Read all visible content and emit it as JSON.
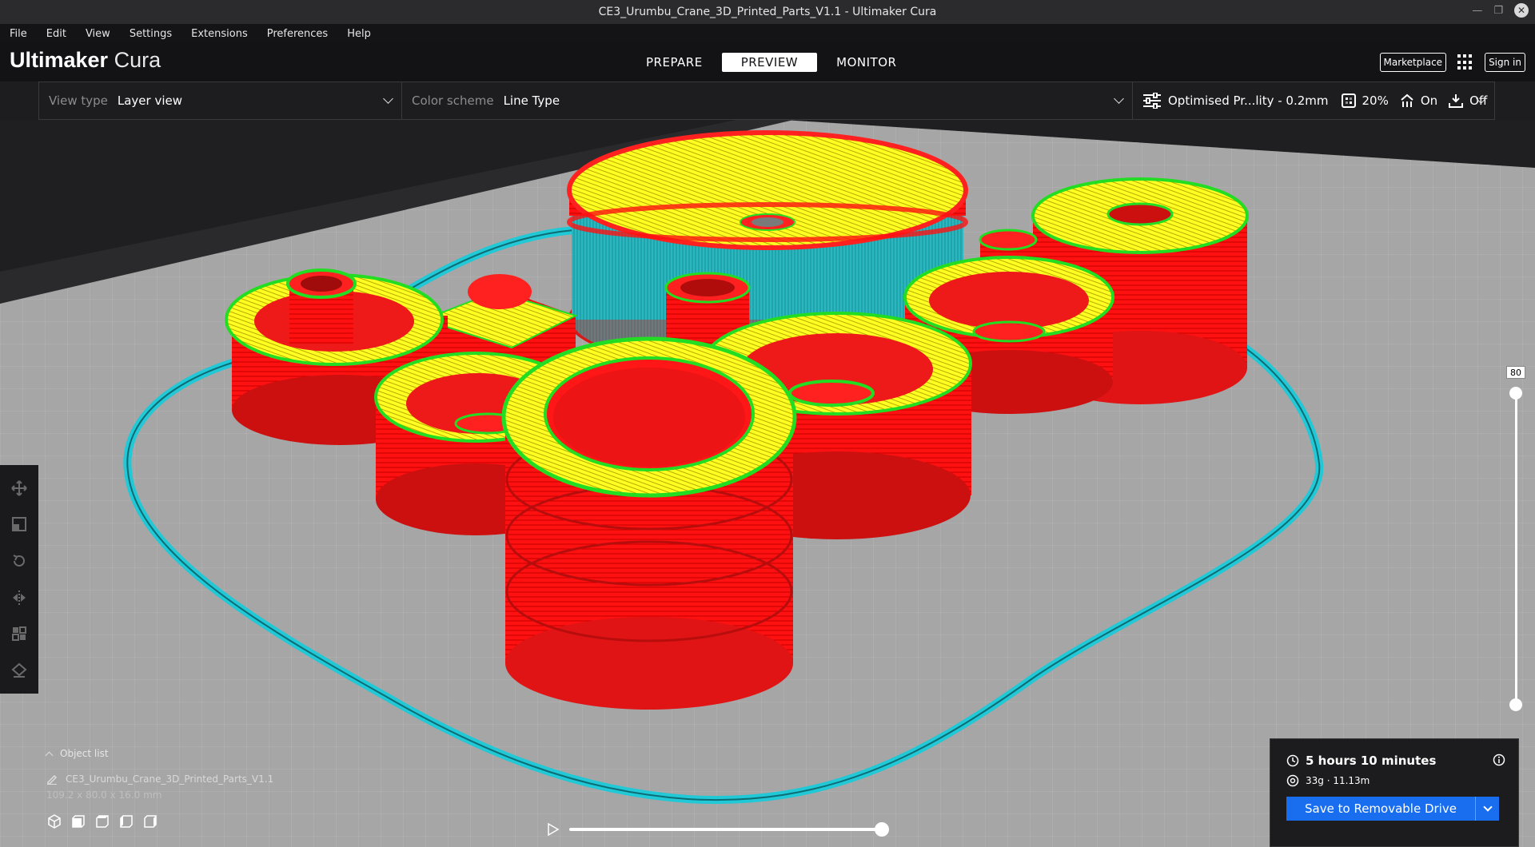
{
  "window": {
    "title": "CE3_Urumbu_Crane_3D_Printed_Parts_V1.1 - Ultimaker Cura"
  },
  "menu": [
    "File",
    "Edit",
    "View",
    "Settings",
    "Extensions",
    "Preferences",
    "Help"
  ],
  "header": {
    "logo_bold": "Ultimaker",
    "logo_light": "Cura",
    "stages": [
      {
        "label": "PREPARE",
        "active": false
      },
      {
        "label": "PREVIEW",
        "active": true
      },
      {
        "label": "MONITOR",
        "active": false
      }
    ],
    "marketplace_label": "Marketplace",
    "sign_in_label": "Sign in"
  },
  "toolbar": {
    "view_type_label": "View type",
    "view_type_value": "Layer view",
    "color_scheme_label": "Color scheme",
    "color_scheme_value": "Line Type",
    "profile": "Optimised Pr...lity - 0.2mm",
    "infill": "20%",
    "support": "On",
    "adhesion": "Off"
  },
  "layer_slider": {
    "value": "80",
    "fraction": 1.0
  },
  "object_list": {
    "title": "Object list",
    "object_name": "CE3_Urumbu_Crane_3D_Printed_Parts_V1.1",
    "dimensions": "109.2 x 80.0 x 16.0 mm"
  },
  "print_panel": {
    "time": "5 hours 10 minutes",
    "material": "33g · 11.13m",
    "save_label": "Save to Removable Drive"
  },
  "simulation": {
    "progress": 1.0
  },
  "colors": {
    "wall_red": "#ff1111",
    "skin_yellow": "#ffff00",
    "inner_wall_green": "#22dd22",
    "support_cyan": "#1ec8d2",
    "build_plate": "#a4a4a4",
    "accent_blue": "#196ef0"
  }
}
